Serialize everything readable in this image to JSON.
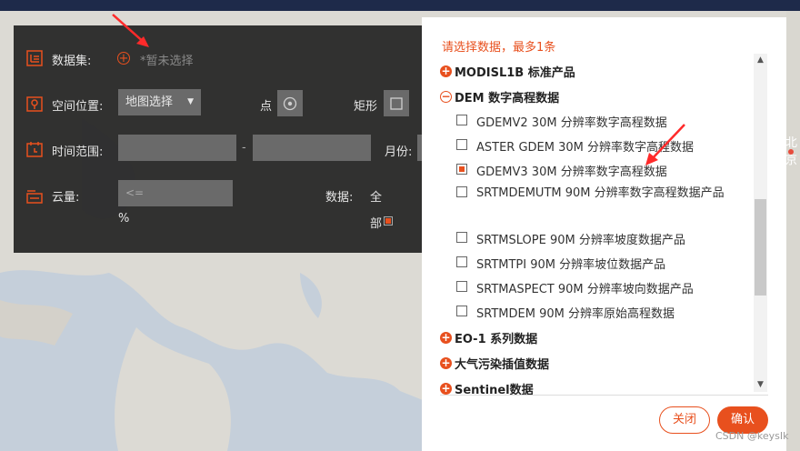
{
  "map": {
    "city_label": "北京"
  },
  "filter_panel": {
    "dataset_label": "数据集:",
    "dataset_placeholder": "*暂未选择",
    "location_label": "空间位置:",
    "location_select": "地图选择",
    "point_label": "点",
    "rect_label": "矩形",
    "time_label": "时间范围:",
    "time_separator": "-",
    "month_label": "月份:",
    "cloud_label": "云量:",
    "cloud_placeholder": "<=",
    "cloud_unit": "%",
    "data_label": "数据:",
    "all_label_1": "全",
    "all_label_2": "部"
  },
  "dialog": {
    "title": "请选择数据，最多1条",
    "groups": [
      {
        "label": "MODISL1B 标准产品",
        "expanded": false
      },
      {
        "label": "DEM 数字高程数据",
        "expanded": true
      },
      {
        "label": "EO-1 系列数据",
        "expanded": false
      },
      {
        "label": "大气污染插值数据",
        "expanded": false
      },
      {
        "label": "Sentinel数据",
        "expanded": false
      }
    ],
    "items": [
      {
        "label": "GDEMV2 30M 分辨率数字高程数据",
        "checked": false
      },
      {
        "label": "ASTER GDEM 30M 分辨率数字高程数据",
        "checked": false
      },
      {
        "label": "GDEMV3 30M 分辨率数字高程数据",
        "checked": true
      },
      {
        "label": "SRTMDEMUTM 90M 分辨率数字高程数据产品",
        "checked": false
      },
      {
        "label": "SRTMSLOPE 90M 分辨率坡度数据产品",
        "checked": false
      },
      {
        "label": "SRTMTPI 90M 分辨率坡位数据产品",
        "checked": false
      },
      {
        "label": "SRTMASPECT 90M 分辨率坡向数据产品",
        "checked": false
      },
      {
        "label": "SRTMDEM 90M 分辨率原始高程数据",
        "checked": false
      }
    ],
    "close_label": "关闭",
    "ok_label": "确认"
  },
  "watermark": "CSDN @keysIk",
  "colors": {
    "accent": "#e8501e",
    "annotation_arrow": "#ff2a2a"
  }
}
